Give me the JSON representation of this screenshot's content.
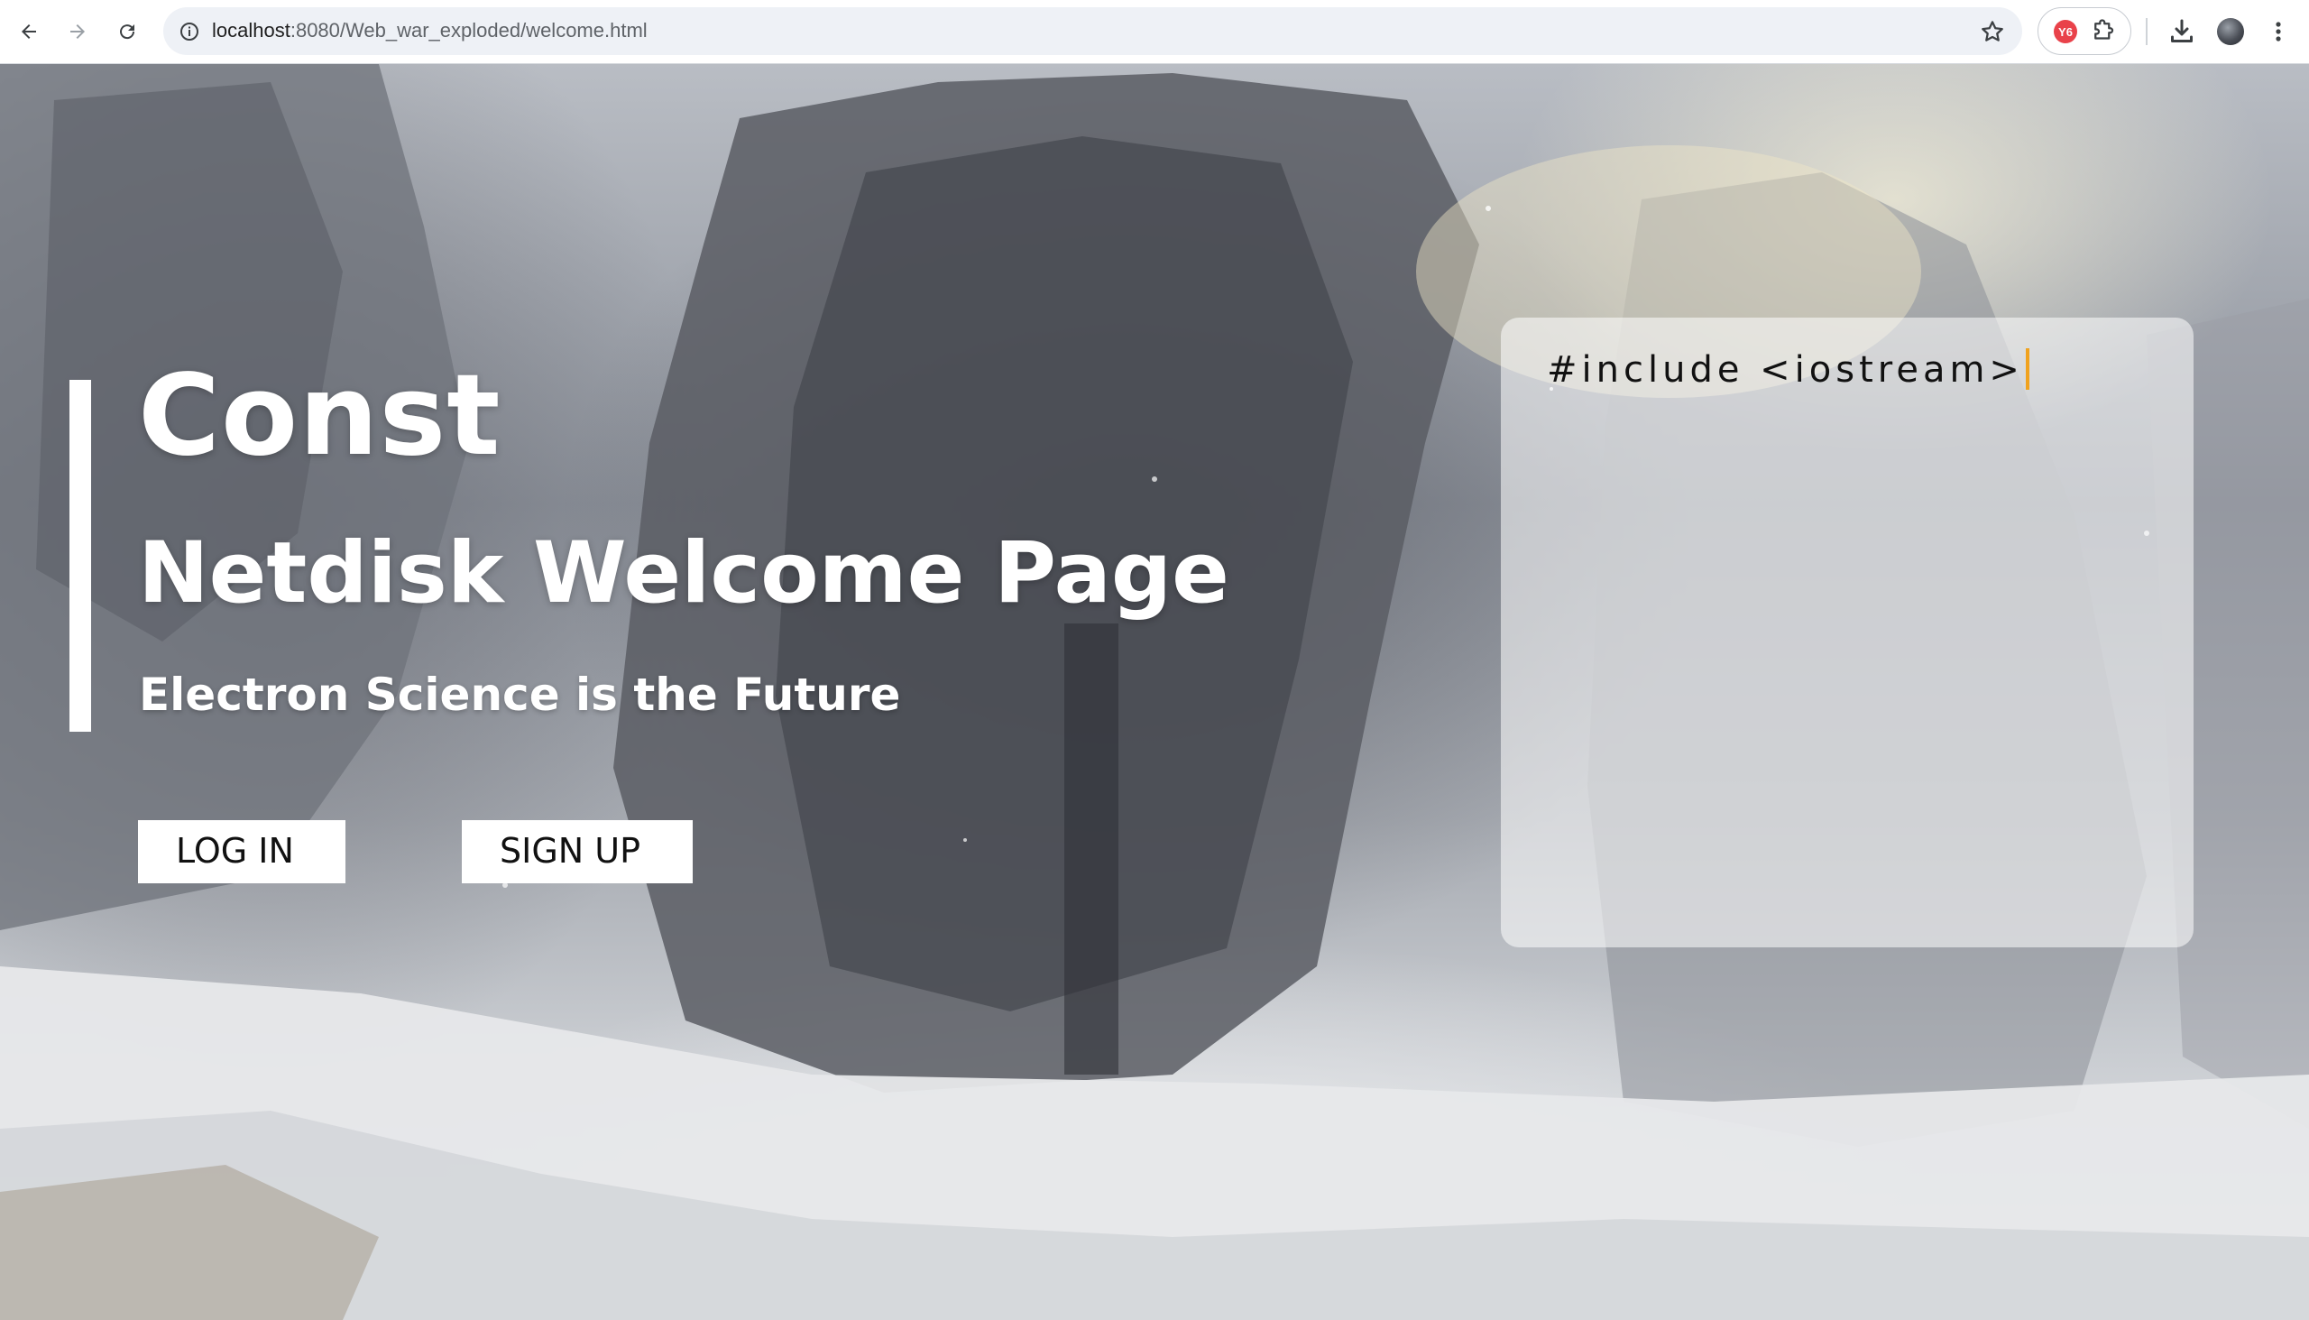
{
  "browser": {
    "url_host": "localhost",
    "url_path": ":8080/Web_war_exploded/welcome.html",
    "extension_badge": "Y6"
  },
  "hero": {
    "title": "Const",
    "subtitle": "Netdisk Welcome Page",
    "tagline": "Electron Science is the Future"
  },
  "buttons": {
    "login_label": "LOG IN",
    "signup_label": "SIGN UP"
  },
  "code_card": {
    "typed_text": "#include <iostream>"
  },
  "colors": {
    "accent_bar": "#ffffff",
    "cursor": "#f0a21e",
    "button_bg": "#ffffff"
  },
  "icons": [
    "back-arrow-icon",
    "forward-arrow-icon",
    "reload-icon",
    "site-info-icon",
    "bookmark-star-icon",
    "extensions-puzzle-icon",
    "download-icon",
    "profile-avatar",
    "more-menu-icon"
  ]
}
